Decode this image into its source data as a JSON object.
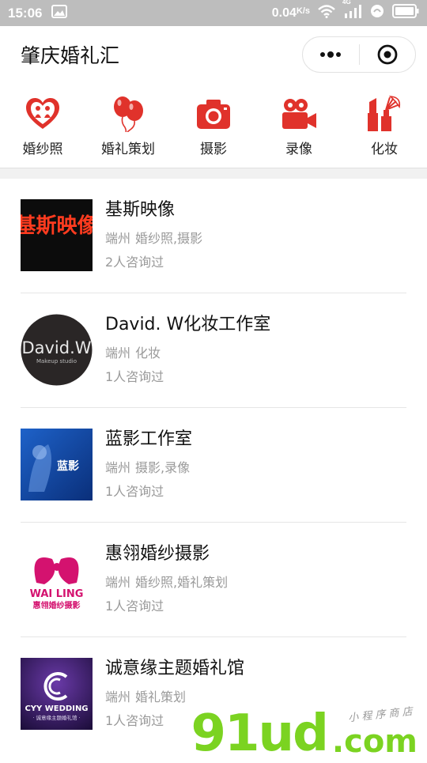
{
  "status_bar": {
    "time": "15:06",
    "network_speed": "0.04",
    "speed_unit": "K/s",
    "network_type": "4G",
    "icons": [
      "image-icon",
      "wifi-icon",
      "signal-icon",
      "data-saver-icon",
      "battery-icon"
    ]
  },
  "navbar": {
    "title": "肇庆婚礼汇",
    "more_icon": "more-dots-icon",
    "close_icon": "target-close-icon"
  },
  "categories": [
    {
      "label": "婚纱照",
      "icon": "heart-couple-icon"
    },
    {
      "label": "婚礼策划",
      "icon": "balloons-icon"
    },
    {
      "label": "摄影",
      "icon": "camera-icon"
    },
    {
      "label": "录像",
      "icon": "video-camera-icon"
    },
    {
      "label": "化妆",
      "icon": "makeup-icon"
    }
  ],
  "colors": {
    "accent": "#e0322b",
    "status_bar": "#bdbdbd",
    "watermark_green": "#7bd321"
  },
  "vendors": [
    {
      "name": "基斯映像",
      "location": "端州",
      "category": "婚纱照,摄影",
      "consults": "2人咨询过",
      "logo_text": "基斯映像"
    },
    {
      "name": "David. W化妆工作室",
      "location": "端州",
      "category": "化妆",
      "consults": "1人咨询过",
      "logo_text": "David.W",
      "logo_sub": "Makeup studio"
    },
    {
      "name": "蓝影工作室",
      "location": "端州",
      "category": "摄影,录像",
      "consults": "1人咨询过",
      "logo_text": "蓝影"
    },
    {
      "name": "惠翎婚纱摄影",
      "location": "端州",
      "category": "婚纱照,婚礼策划",
      "consults": "1人咨询过",
      "logo_text": "WAI LING",
      "logo_sub": "惠翎婚纱摄影"
    },
    {
      "name": "诚意缘主题婚礼馆",
      "location": "端州",
      "category": "婚礼策划",
      "consults": "1人咨询过",
      "logo_text": "CYY WEDDING",
      "logo_sub": "· 诚意缘主题婚礼馆 ·"
    }
  ],
  "watermark": {
    "main": "91ud",
    "suffix": ".com",
    "subtitle": "小 程 序 商 店"
  }
}
